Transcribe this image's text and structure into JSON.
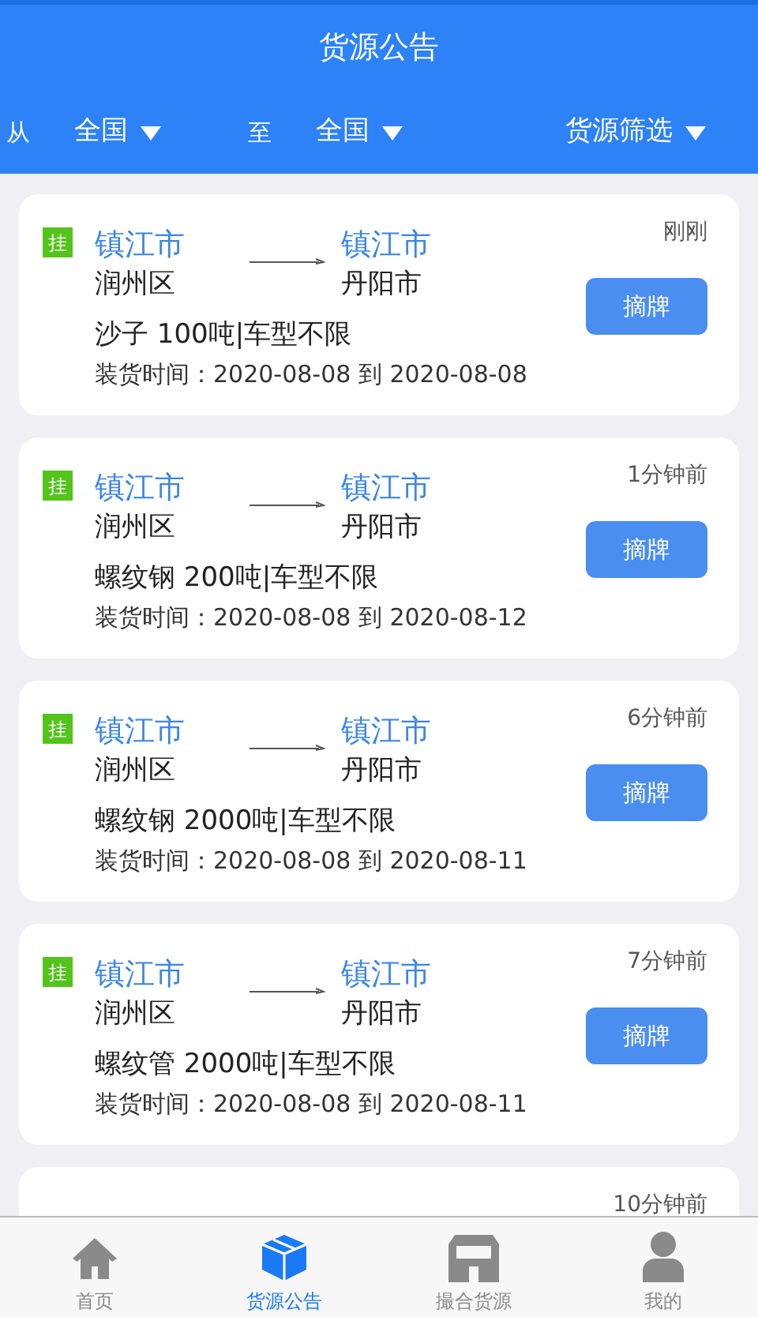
{
  "header": {
    "title": "货源公告"
  },
  "filters": {
    "from_label": "从",
    "from_value": "全国",
    "to_label": "至",
    "to_value": "全国",
    "filter": "货源筛选"
  },
  "cards": [
    {
      "tag": "挂",
      "from_city": "镇江市",
      "to_city": "镇江市",
      "from_district": "润州区",
      "to_district": "丹阳市",
      "cargo": "沙子 100吨|车型不限",
      "loading": "装货时间：2020-08-08 到 2020-08-08",
      "time": "刚刚",
      "action": "摘牌"
    },
    {
      "tag": "挂",
      "from_city": "镇江市",
      "to_city": "镇江市",
      "from_district": "润州区",
      "to_district": "丹阳市",
      "cargo": "螺纹钢 200吨|车型不限",
      "loading": "装货时间：2020-08-08 到 2020-08-12",
      "time": "1分钟前",
      "action": "摘牌"
    },
    {
      "tag": "挂",
      "from_city": "镇江市",
      "to_city": "镇江市",
      "from_district": "润州区",
      "to_district": "丹阳市",
      "cargo": "螺纹钢 2000吨|车型不限",
      "loading": "装货时间：2020-08-08 到 2020-08-11",
      "time": "6分钟前",
      "action": "摘牌"
    },
    {
      "tag": "挂",
      "from_city": "镇江市",
      "to_city": "镇江市",
      "from_district": "润州区",
      "to_district": "丹阳市",
      "cargo": "螺纹管 2000吨|车型不限",
      "loading": "装货时间：2020-08-08 到 2020-08-11",
      "time": "7分钟前",
      "action": "摘牌"
    },
    {
      "time": "10分钟前"
    }
  ],
  "tabs": [
    {
      "kind": "home",
      "label": "首页",
      "selected": false
    },
    {
      "kind": "box",
      "label": "货源公告",
      "selected": true
    },
    {
      "kind": "store",
      "label": "撮合货源",
      "selected": false
    },
    {
      "kind": "user",
      "label": "我的",
      "selected": false
    }
  ]
}
